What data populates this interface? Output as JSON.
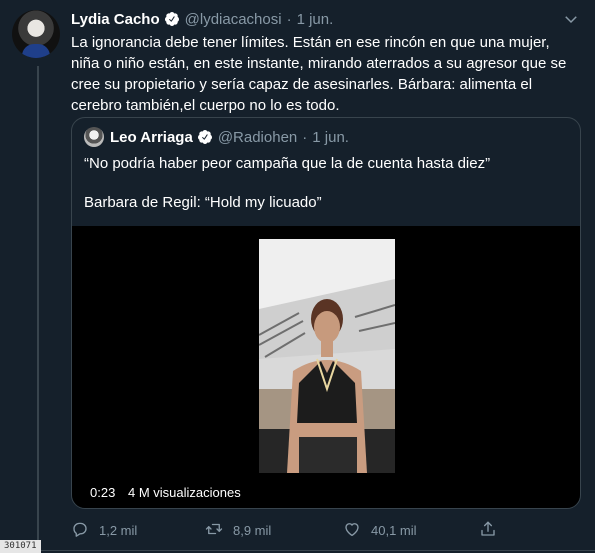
{
  "tweet": {
    "author_name": "Lydia Cacho",
    "author_handle": "@lydiacachosi",
    "separator": "·",
    "date": "1 jun.",
    "lines": [
      "La ignorancia debe tener límites. Están en ese rincón en que una mujer,",
      "niña o niño están, en este instante, mirando aterrados a su agresor que se",
      "cree su propietario y sería capaz de asesinarles. Bárbara: alimenta el",
      "cerebro también,el cuerpo no lo es todo."
    ]
  },
  "quoted": {
    "author_name": "Leo Arriaga",
    "author_handle": "@Radiohen",
    "separator": "·",
    "date": "1 jun.",
    "line1": "“No podría haber peor campaña que la de cuenta hasta diez”",
    "line2": "Barbara de Regil: “Hold my licuado”",
    "video": {
      "duration": "0:23",
      "views": "4 M visualizaciones"
    }
  },
  "actions": {
    "reply_count": "1,2 mil",
    "retweet_count": "8,9 mil",
    "like_count": "40,1 mil"
  },
  "corner_tag": "301071",
  "colors": {
    "background": "#15202b",
    "muted": "#8899a6",
    "border": "#38444d",
    "verified": "#1da1f2"
  },
  "icons": [
    "verified-badge-icon",
    "chevron-down-icon",
    "reply-icon",
    "retweet-icon",
    "like-icon",
    "share-icon"
  ]
}
